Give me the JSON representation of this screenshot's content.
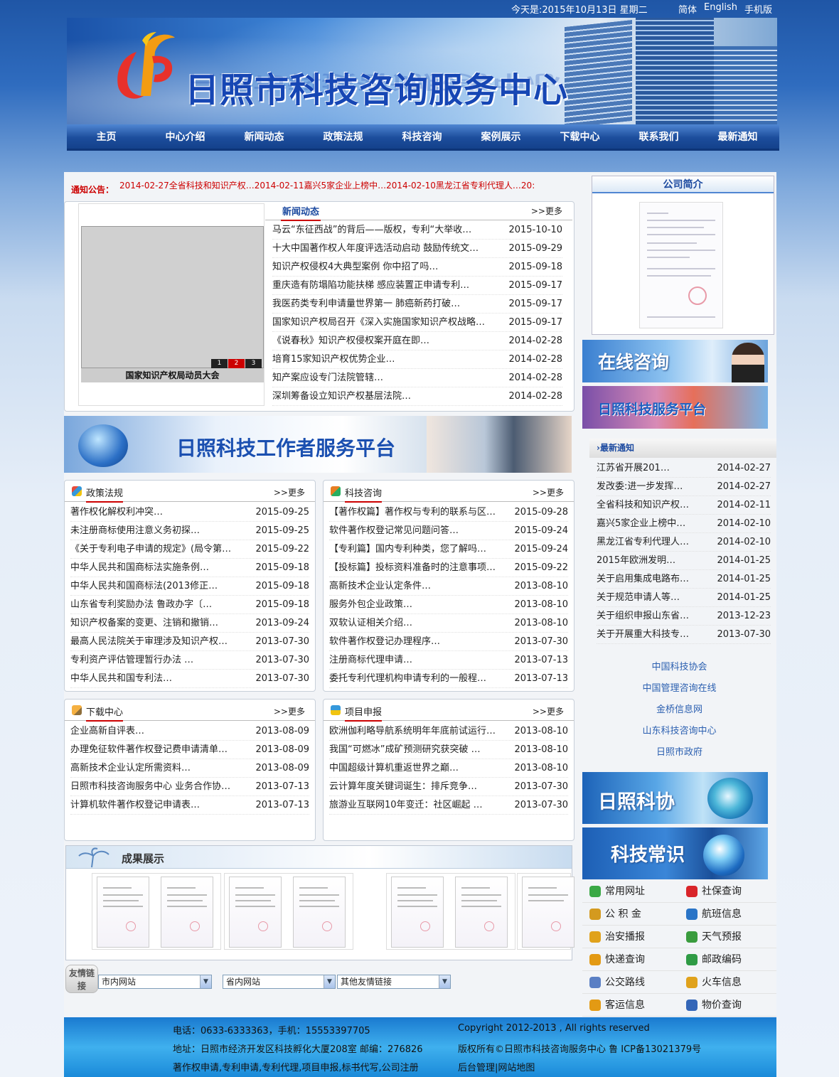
{
  "topbar": {
    "date": "今天是:2015年10月13日 星期二",
    "lang_simplified": "简体",
    "lang_english": "English",
    "lang_mobile": "手机版"
  },
  "banner": {
    "title": "日照市科技咨询服务中心"
  },
  "nav": [
    "主页",
    "中心介绍",
    "新闻动态",
    "政策法规",
    "科技咨询",
    "案例展示",
    "下载中心",
    "联系我们",
    "最新通知"
  ],
  "notice": {
    "label": "通知公告：",
    "items": [
      {
        "date": "2014-02-27",
        "text": "全省科技和知识产权…"
      },
      {
        "date": "2014-02-11",
        "text": "嘉兴5家企业上榜中…"
      },
      {
        "date": "2014-02-10",
        "text": "黑龙江省专利代理人…"
      },
      {
        "date": "20:",
        "text": ""
      }
    ]
  },
  "slideshow": {
    "caption": "国家知识产权局动员大会",
    "pages": [
      "1",
      "2",
      "3"
    ],
    "active": "2"
  },
  "news": {
    "title": "新闻动态",
    "more": ">>更多",
    "rows": [
      {
        "t": "马云“东征西战”的背后——版权，专利“大举收…",
        "d": "2015-10-10"
      },
      {
        "t": "十大中国著作权人年度评选活动启动 鼓励传统文…",
        "d": "2015-09-29"
      },
      {
        "t": "知识产权侵权4大典型案例 你中招了吗…",
        "d": "2015-09-18"
      },
      {
        "t": "重庆造有防塌陷功能扶梯 感应装置正申请专利…",
        "d": "2015-09-17"
      },
      {
        "t": "我医药类专利申请量世界第一 肺癌新药打破…",
        "d": "2015-09-17"
      },
      {
        "t": "国家知识产权局召开《深入实施国家知识产权战略…",
        "d": "2015-09-17"
      },
      {
        "t": "《说春秋》知识产权侵权案开庭在即…",
        "d": "2014-02-28"
      },
      {
        "t": "培育15家知识产权优势企业…",
        "d": "2014-02-28"
      },
      {
        "t": "知产案应设专门法院管辖…",
        "d": "2014-02-28"
      },
      {
        "t": "深圳筹备设立知识产权基层法院…",
        "d": "2014-02-28"
      }
    ]
  },
  "promo": {
    "title": "日照科技工作者服务平台"
  },
  "policy": {
    "title": "政策法规",
    "more": ">>更多",
    "rows": [
      {
        "t": "著作权化解权利冲突…",
        "d": "2015-09-25"
      },
      {
        "t": "未注册商标使用注意义务初探…",
        "d": "2015-09-25"
      },
      {
        "t": "《关于专利电子申请的规定》(局令第…",
        "d": "2015-09-22"
      },
      {
        "t": "中华人民共和国商标法实施条例…",
        "d": "2015-09-18"
      },
      {
        "t": "中华人民共和国商标法(2013修正…",
        "d": "2015-09-18"
      },
      {
        "t": "山东省专利奖励办法 鲁政办字〔…",
        "d": "2015-09-18"
      },
      {
        "t": "知识产权备案的变更、注销和撤销…",
        "d": "2013-09-24"
      },
      {
        "t": "最高人民法院关于审理涉及知识产权…",
        "d": "2013-07-30"
      },
      {
        "t": "专利资产评估管理暂行办法 …",
        "d": "2013-07-30"
      },
      {
        "t": "中华人民共和国专利法…",
        "d": "2013-07-30"
      }
    ]
  },
  "consult": {
    "title": "科技咨询",
    "more": ">>更多",
    "rows": [
      {
        "t": "【著作权篇】著作权与专利的联系与区…",
        "d": "2015-09-28"
      },
      {
        "t": "软件著作权登记常见问题问答…",
        "d": "2015-09-24"
      },
      {
        "t": "【专利篇】国内专利种类，您了解吗…",
        "d": "2015-09-24"
      },
      {
        "t": "【投标篇】投标资料准备时的注意事项…",
        "d": "2015-09-22"
      },
      {
        "t": "高新技术企业认定条件…",
        "d": "2013-08-10"
      },
      {
        "t": "服务外包企业政策…",
        "d": "2013-08-10"
      },
      {
        "t": "双软认证相关介绍…",
        "d": "2013-08-10"
      },
      {
        "t": "软件著作权登记办理程序…",
        "d": "2013-07-30"
      },
      {
        "t": "注册商标代理申请…",
        "d": "2013-07-13"
      },
      {
        "t": "委托专利代理机构申请专利的一般程…",
        "d": "2013-07-13"
      }
    ]
  },
  "download": {
    "title": "下载中心",
    "more": ">>更多",
    "rows": [
      {
        "t": "企业高新自评表…",
        "d": "2013-08-09"
      },
      {
        "t": "办理免征软件著作权登记费申请清单…",
        "d": "2013-08-09"
      },
      {
        "t": "高新技术企业认定所需资料…",
        "d": "2013-08-09"
      },
      {
        "t": "日照市科技咨询服务中心 业务合作协…",
        "d": "2013-07-13"
      },
      {
        "t": "计算机软件著作权登记申请表…",
        "d": "2013-07-13"
      }
    ]
  },
  "project": {
    "title": "项目申报",
    "more": ">>更多",
    "rows": [
      {
        "t": "欧洲伽利略导航系统明年年底前试运行…",
        "d": "2013-08-10"
      },
      {
        "t": "我国“可燃冰”成矿预测研究获突破 …",
        "d": "2013-08-10"
      },
      {
        "t": "中国超级计算机重返世界之巅…",
        "d": "2013-08-10"
      },
      {
        "t": "云计算年度关键词诞生：排斥竞争…",
        "d": "2013-07-30"
      },
      {
        "t": "旅游业互联网10年变迁：社区崛起 …",
        "d": "2013-07-30"
      }
    ]
  },
  "results": {
    "title": "成果展示"
  },
  "friend_links": {
    "label": "友情链接",
    "select1": "市内网站",
    "select2": "省内网站",
    "select3": "其他友情链接"
  },
  "about": {
    "title": "公司简介"
  },
  "right_banners": {
    "online": "在线咨询",
    "service": "日照科技服务平台",
    "assoc": "日照科协",
    "knowledge": "科技常识"
  },
  "newest": {
    "title": "›最新通知",
    "rows": [
      {
        "t": "江苏省开展201…",
        "d": "2014-02-27"
      },
      {
        "t": "发改委:进一步发挥…",
        "d": "2014-02-27"
      },
      {
        "t": "全省科技和知识产权…",
        "d": "2014-02-11"
      },
      {
        "t": "嘉兴5家企业上榜中…",
        "d": "2014-02-10"
      },
      {
        "t": "黑龙江省专利代理人…",
        "d": "2014-02-10"
      },
      {
        "t": "2015年欧洲发明…",
        "d": "2014-01-25"
      },
      {
        "t": "关于启用集成电路布…",
        "d": "2014-01-25"
      },
      {
        "t": "关于规范申请人等…",
        "d": "2014-01-25"
      },
      {
        "t": "关于组织申报山东省…",
        "d": "2013-12-23"
      },
      {
        "t": "关于开展重大科技专…",
        "d": "2013-07-30"
      }
    ]
  },
  "ext_links": [
    "中国科技协会",
    "中国管理咨询在线",
    "金桥信息网",
    "山东科技咨询中心",
    "日照市政府"
  ],
  "tools": [
    {
      "l": "常用网址",
      "icon": "globe-icon",
      "color": "#3aa845"
    },
    {
      "l": "社保查询",
      "icon": "heart-icon",
      "color": "#d9252a"
    },
    {
      "l": "公 积 金",
      "icon": "coins-icon",
      "color": "#d49a1f"
    },
    {
      "l": "航班信息",
      "icon": "chart-icon",
      "color": "#2a74c7"
    },
    {
      "l": "治安播报",
      "icon": "megaphone-icon",
      "color": "#e0a21c"
    },
    {
      "l": "天气预报",
      "icon": "weather-icon",
      "color": "#3a9c3e"
    },
    {
      "l": "快递查询",
      "icon": "box-icon",
      "color": "#e39a14"
    },
    {
      "l": "邮政编码",
      "icon": "mail-icon",
      "color": "#2f9b45"
    },
    {
      "l": "公交路线",
      "icon": "bus-icon",
      "color": "#5a7fc4"
    },
    {
      "l": "火车信息",
      "icon": "train-icon",
      "color": "#e0a21c"
    },
    {
      "l": "客运信息",
      "icon": "coach-icon",
      "color": "#e39a14"
    },
    {
      "l": "物价查询",
      "icon": "people-icon",
      "color": "#3466b8"
    }
  ],
  "footer": {
    "phone": "电话：0633-6333363，手机：15553397705",
    "address": "地址：日照市经济开发区科技孵化大厦208室 邮编：276826",
    "services": "著作权申请,专利申请,专利代理,项目申报,标书代写,公司注册",
    "copyright": "Copyright 2012-2013 , All rights reserved",
    "owner": "版权所有©日照市科技咨询服务中心 鲁 ICP备13021379号",
    "admin": "后台管理|网站地图"
  }
}
